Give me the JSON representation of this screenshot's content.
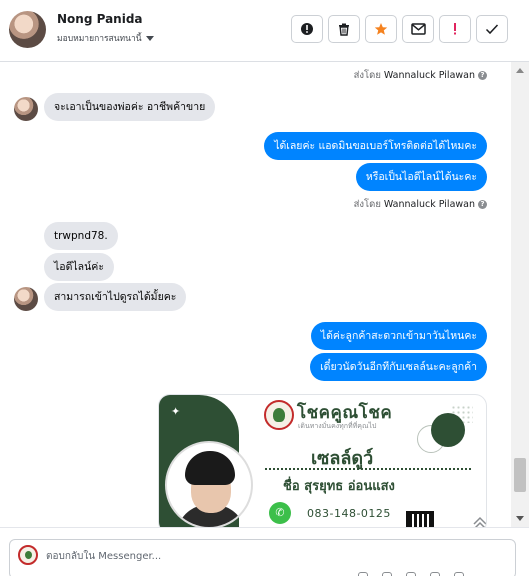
{
  "header": {
    "contact_name": "Nong Panida",
    "assign_label": "มอบหมายการสนทนานี้"
  },
  "toolbar": {
    "buttons": [
      {
        "name": "mark-spam-button",
        "icon": "alert-circle-icon"
      },
      {
        "name": "delete-button",
        "icon": "trash-icon"
      },
      {
        "name": "star-button",
        "icon": "star-icon",
        "color": "#f5821f"
      },
      {
        "name": "mark-unread-button",
        "icon": "envelope-icon"
      },
      {
        "name": "follow-up-button",
        "icon": "exclamation-icon",
        "color": "#e0245e"
      },
      {
        "name": "mark-done-button",
        "icon": "check-icon"
      }
    ]
  },
  "messages": {
    "sent_by_1": {
      "prefix": "ส่งโดย",
      "name": "Wannaluck Pilawan"
    },
    "in_1": "จะเอาเป็นของพ่อค่ะ อาชีพค้าขาย",
    "out_1": "ได้เลยค่ะ แอดมินขอเบอร์โทรติดต่อได้ไหมคะ",
    "out_2": "หรือเป็นไอดีไลน์ได้นะคะ",
    "sent_by_2": {
      "prefix": "ส่งโดย",
      "name": "Wannaluck Pilawan"
    },
    "in_2": "trwpnd78.",
    "in_3": "ไอดีไลน์ค่ะ",
    "in_4": "สามารถเข้าไปดูรถได้มั้ยคะ",
    "out_3": "ได้ค่ะลูกค้าสะดวกเข้ามาวันไหนคะ",
    "out_4": "เดี๋ยวนัดวันอีกทีกับเซลล์นะคะลูกค้า"
  },
  "card": {
    "brand": "โชคคูณโชค",
    "brand_sub": "เดินทางมั่นคงทุกที่ที่คุณไป",
    "role": "เซลล์ดูว์",
    "name": "ชื่อ สุรยุทธ อ่อนแสง",
    "phone": "083-148-0125"
  },
  "composer": {
    "placeholder": "ตอบกลับใน Messenger..."
  },
  "colors": {
    "outgoing_bubble": "#0084ff",
    "incoming_bubble": "#e4e6eb",
    "card_green": "#2e4f34"
  }
}
